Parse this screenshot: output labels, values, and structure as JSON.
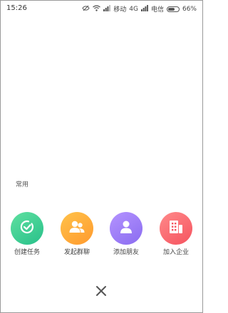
{
  "status_bar": {
    "time": "15:26",
    "carrier1": "移动",
    "network": "4G",
    "carrier2": "电信",
    "battery_percent": "66%",
    "battery_level": 0.66
  },
  "section_label": "常用",
  "actions": [
    {
      "label": "创建任务",
      "icon": "check-circle-icon",
      "color_from": "#5fe0a0",
      "color_to": "#28c08a"
    },
    {
      "label": "发起群聊",
      "icon": "group-icon",
      "color_from": "#ffc24a",
      "color_to": "#ff9a2e"
    },
    {
      "label": "添加朋友",
      "icon": "person-icon",
      "color_from": "#b493ff",
      "color_to": "#8a6cf0"
    },
    {
      "label": "加入企业",
      "icon": "building-icon",
      "color_from": "#ff8a8a",
      "color_to": "#f5535f"
    }
  ],
  "close": {
    "icon": "close-icon"
  }
}
